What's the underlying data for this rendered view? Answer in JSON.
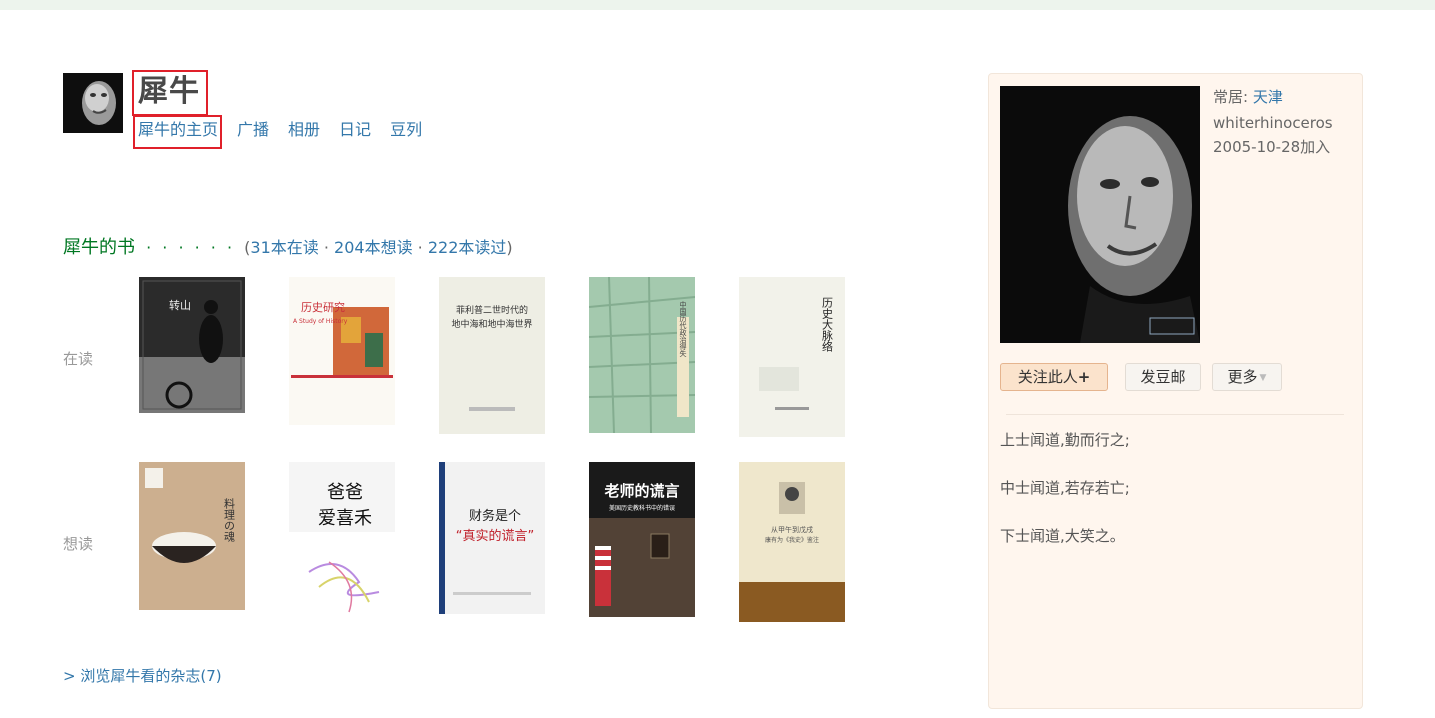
{
  "profile": {
    "name": "犀牛",
    "nav": [
      "犀牛的主页",
      "广播",
      "相册",
      "日记",
      "豆列"
    ]
  },
  "books": {
    "title": "犀牛的书",
    "dots": "· · · · · ·",
    "stats_open": "(",
    "reading": "31本在读",
    "sep1": " · ",
    "wish": "204本想读",
    "sep2": " · ",
    "read": "222本读过",
    "stats_close": ")",
    "reading_label": "在读",
    "wish_label": "想读",
    "reading_covers": [
      {
        "text_1": "转山",
        "text_2": ""
      },
      {
        "text_1": "历史研究",
        "text_2": "A Study of History"
      },
      {
        "text_1": "菲利普二世时代的",
        "text_2": "地中海和地中海世界"
      },
      {
        "text_1": "中国历代政治得失",
        "text_2": ""
      },
      {
        "text_1": "历史大脉络",
        "text_2": ""
      }
    ],
    "wish_covers": [
      {
        "text_1": "料理の魂",
        "text_2": ""
      },
      {
        "text_1": "爸爸",
        "text_2": "爱喜禾"
      },
      {
        "text_1": "财务是个",
        "text_2": "“真实的谎言”"
      },
      {
        "text_1": "老师的谎言",
        "text_2": "美国历史教科书中的错误"
      },
      {
        "text_1": "从甲午到戊戌",
        "text_2": "康有为《我史》鉴注"
      }
    ]
  },
  "magazine_link": "> 浏览犀牛看的杂志(7)",
  "side": {
    "location_prefix": "常居: ",
    "location": "天津",
    "username": "whiterhinoceros",
    "joined": "2005-10-28加入",
    "follow_button": "关注此人",
    "follow_plus": "+",
    "mail_button": "发豆邮",
    "more_button": "更多",
    "more_caret": "▼",
    "intro": [
      "上士闻道,勤而行之;",
      "中士闻道,若存若亡;",
      "下士闻道,大笑之。"
    ]
  },
  "colors": {
    "link": "#3377aa",
    "heading_green": "#007722",
    "panel_bg": "#fff6ee",
    "highlight_box": "#e0202a"
  }
}
